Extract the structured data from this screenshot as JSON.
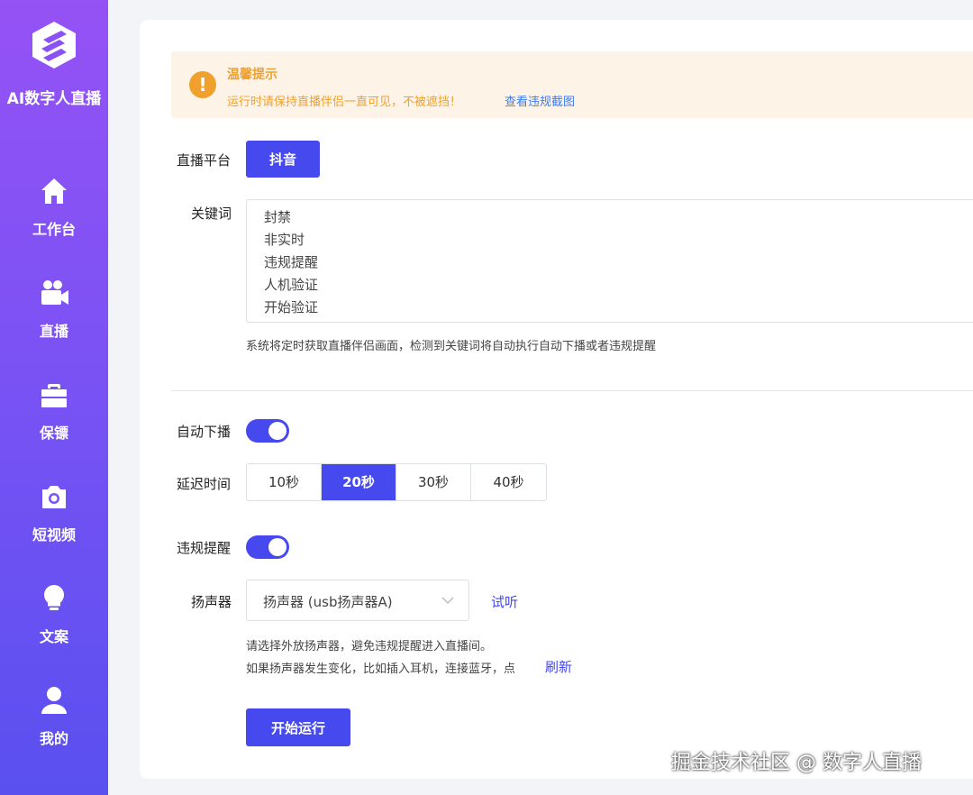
{
  "sidebar": {
    "brand": "AI数字人直播",
    "items": [
      {
        "label": "工作台",
        "icon": "home-icon"
      },
      {
        "label": "直播",
        "icon": "video-camera-icon"
      },
      {
        "label": "保镖",
        "icon": "briefcase-icon"
      },
      {
        "label": "短视频",
        "icon": "camera-icon"
      },
      {
        "label": "文案",
        "icon": "lightbulb-icon"
      },
      {
        "label": "我的",
        "icon": "user-icon"
      }
    ]
  },
  "tip": {
    "title": "温馨提示",
    "text": "运行时请保持直播伴侣一直可见，不被遮挡！",
    "link": "查看违规截图"
  },
  "platform": {
    "label": "直播平台",
    "value": "抖音"
  },
  "keywords": {
    "label": "关键词",
    "lines": [
      "封禁",
      "非实时",
      "违规提醒",
      "人机验证",
      "开始验证"
    ],
    "hint": "系统将定时获取直播伴侣画面，检测到关键词将自动执行自动下播或者违规提醒"
  },
  "auto_stop": {
    "label": "自动下播",
    "on": true
  },
  "delay": {
    "label": "延迟时间",
    "options": [
      "10秒",
      "20秒",
      "30秒",
      "40秒"
    ],
    "selected": "20秒"
  },
  "violation_alert": {
    "label": "违规提醒",
    "on": true
  },
  "speaker": {
    "label": "扬声器",
    "value": "扬声器 (usb扬声器A)",
    "test_link": "试听",
    "hint1": "请选择外放扬声器，避免违规提醒进入直播间。",
    "hint2": "如果扬声器发生变化，比如插入耳机，连接蓝牙，点",
    "refresh_link": "刷新"
  },
  "start_button": "开始运行",
  "watermark": "掘金技术社区 @ 数字人直播",
  "colors": {
    "accent": "#4549ee",
    "warning": "#f0a02c",
    "sidebar_top": "#9552f5",
    "sidebar_bottom": "#5a50f0"
  }
}
